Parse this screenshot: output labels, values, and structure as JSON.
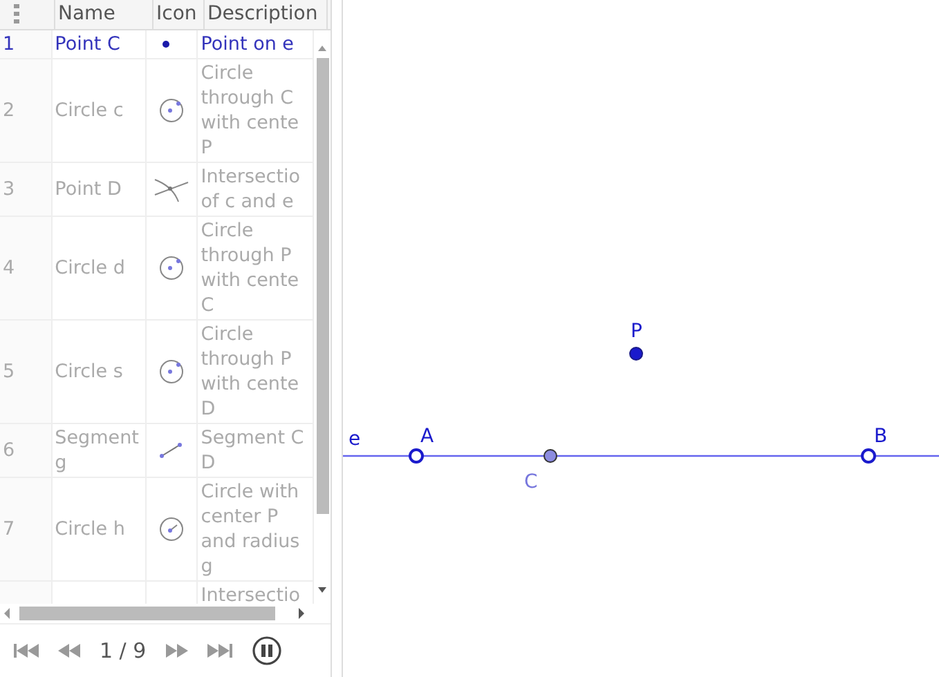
{
  "protocol": {
    "columns": [
      "Name",
      "Icon",
      "Description"
    ],
    "rows": [
      {
        "number": "1",
        "name": [
          "Point C"
        ],
        "kind": "point",
        "description": [
          "Point on e"
        ],
        "selected": true
      },
      {
        "number": "2",
        "name": [
          "Circle c"
        ],
        "kind": "circle",
        "description": [
          "Circle",
          "through C",
          "with cente",
          "P"
        ],
        "selected": false
      },
      {
        "number": "3",
        "name": [
          "Point D"
        ],
        "kind": "intersection",
        "description": [
          "Intersectio",
          "of c and e"
        ],
        "selected": false
      },
      {
        "number": "4",
        "name": [
          "Circle d"
        ],
        "kind": "circle",
        "description": [
          "Circle",
          "through P",
          "with cente",
          "C"
        ],
        "selected": false
      },
      {
        "number": "5",
        "name": [
          "Circle s"
        ],
        "kind": "circle",
        "description": [
          "Circle",
          "through P",
          "with cente",
          "D"
        ],
        "selected": false
      },
      {
        "number": "6",
        "name": [
          "Segment",
          "g"
        ],
        "kind": "segment",
        "description": [
          "Segment C",
          "D"
        ],
        "selected": false
      },
      {
        "number": "7",
        "name": [
          "Circle h"
        ],
        "kind": "radius",
        "description": [
          "Circle with",
          "center P",
          "and radius",
          "g"
        ],
        "selected": false
      },
      {
        "kind": "partial",
        "description": [
          "Intersectio"
        ],
        "selected": false
      }
    ],
    "navigation": {
      "counter": "1 / 9"
    }
  },
  "graphics": {
    "line_label": "e",
    "points": [
      {
        "label": "A",
        "kind": "free"
      },
      {
        "label": "C",
        "kind": "dependent"
      },
      {
        "label": "B",
        "kind": "free"
      },
      {
        "label": "P",
        "kind": "solid"
      }
    ]
  }
}
